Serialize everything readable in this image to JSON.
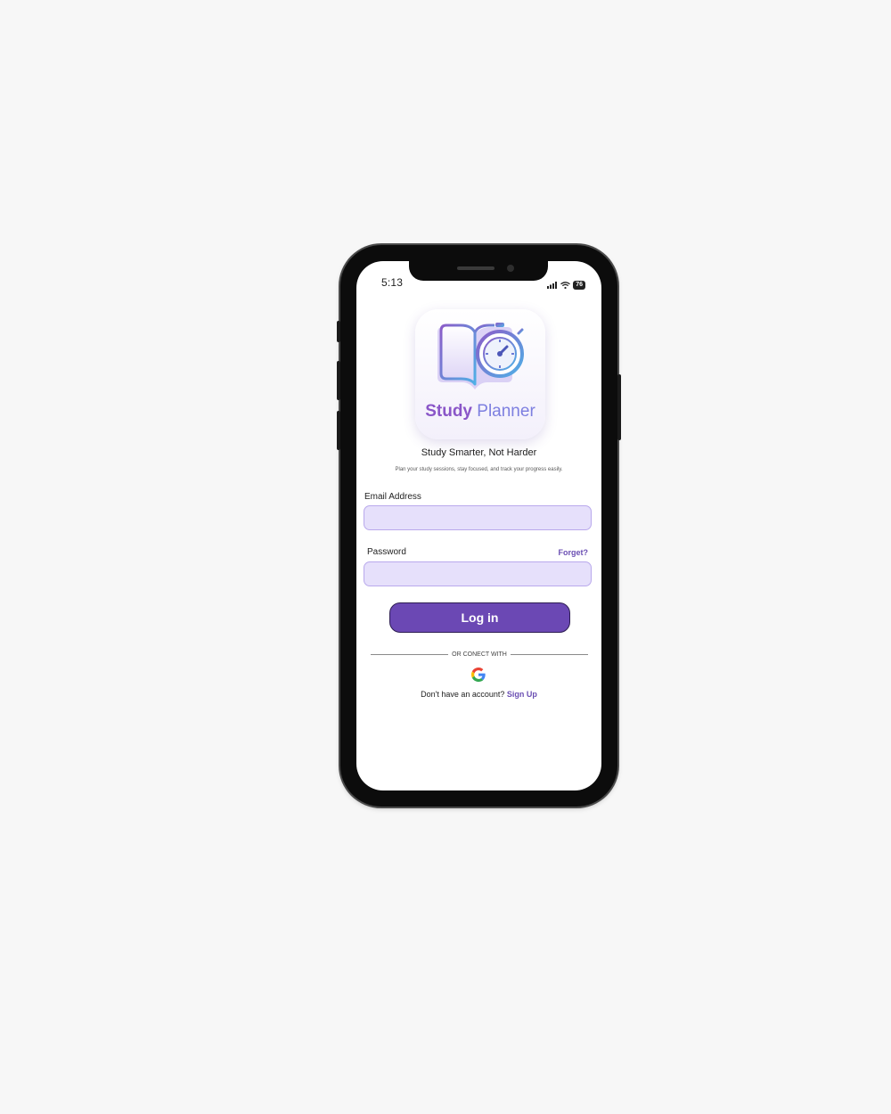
{
  "status_bar": {
    "time": "5:13",
    "battery": "76",
    "icons": [
      "signal-icon",
      "wifi-icon",
      "battery-icon"
    ]
  },
  "app": {
    "name_part1": "Study",
    "name_part2": "Planner",
    "logo_icon": "book-stopwatch-icon"
  },
  "tagline": "Study Smarter, Not Harder",
  "subtitle": "Plan your study sessions, stay focused, and track your progress easily.",
  "form": {
    "email_label": "Email Address",
    "email_value": "",
    "password_label": "Password",
    "password_value": "",
    "forgot_label": "Forget?",
    "login_label": "Log in"
  },
  "divider_text": "OR CONECT WITH",
  "social": {
    "provider": "google-icon"
  },
  "signup": {
    "prompt": "Don't have an account?",
    "link": "Sign Up"
  },
  "colors": {
    "accent": "#6b48b4",
    "input_bg": "#e6e0fb",
    "input_border": "#b9a9ec",
    "link": "#6b4fb3",
    "background": "#f7f7f7"
  }
}
